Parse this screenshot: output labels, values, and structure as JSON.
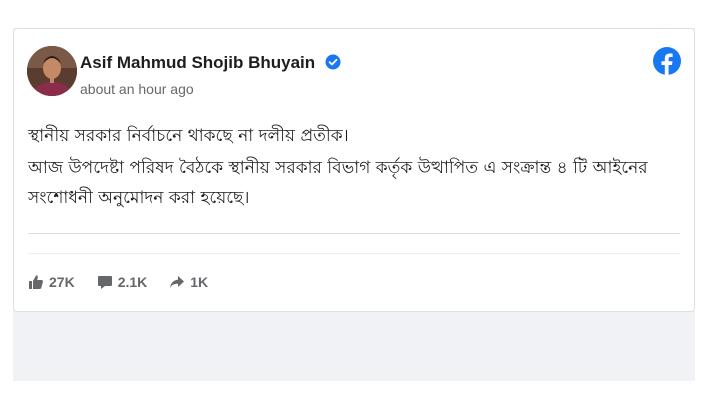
{
  "post": {
    "author": "Asif Mahmud Shojib Bhuyain",
    "timestamp": "about an hour ago",
    "paragraphs": [
      "স্থানীয় সরকার নির্বাচনে থাকছে না দলীয় প্রতীক।",
      "আজ উপদেষ্টা পরিষদ বৈঠকে স্থানীয় সরকার বিভাগ কর্তৃক উত্থাপিত এ সংক্রান্ত ৪ টি আইনের সংশোধনী অনুমোদন করা হয়েছে।"
    ]
  },
  "stats": {
    "likes": "27K",
    "comments": "2.1K",
    "shares": "1K"
  },
  "icons": {
    "verified": "verified-badge-icon",
    "platform": "facebook-logo-icon",
    "like": "like-icon",
    "comment": "comment-icon",
    "share": "share-icon"
  },
  "colors": {
    "brand": "#1877f2",
    "text": "#1c1e21",
    "muted": "#65676b",
    "background": "#f0f2f5"
  }
}
